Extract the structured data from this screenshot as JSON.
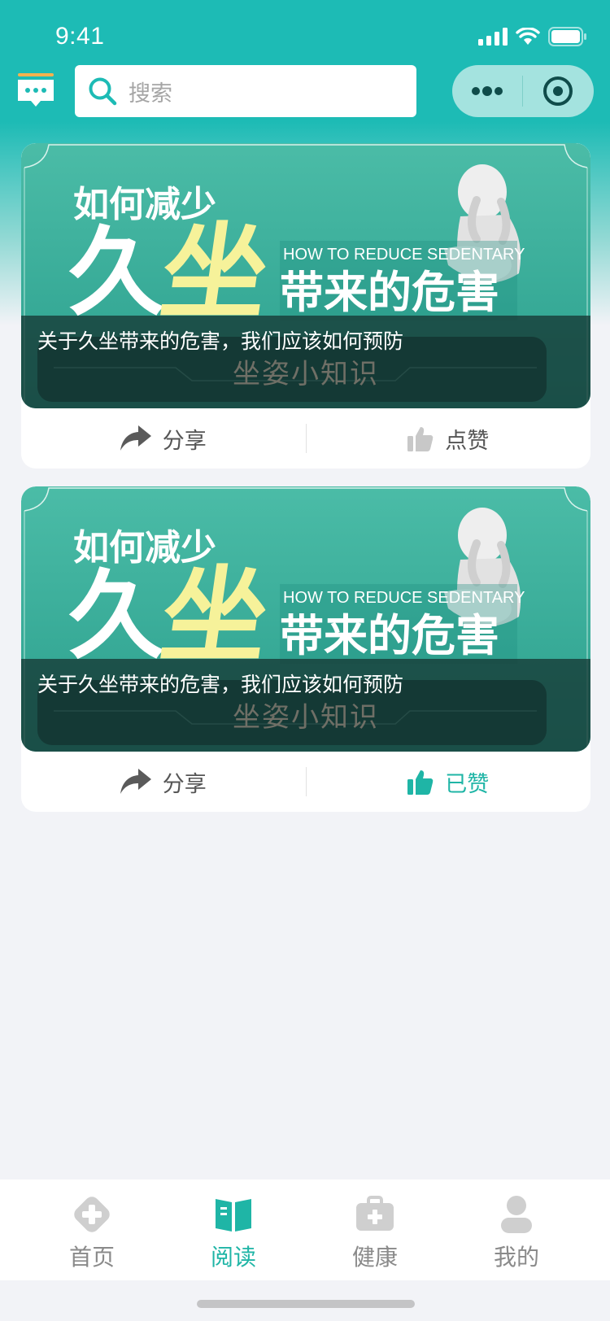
{
  "status_bar": {
    "time": "9:41"
  },
  "search": {
    "placeholder": "搜索"
  },
  "colors": {
    "brand": "#1dbbb5",
    "accent": "#1fb5a6",
    "background": "#f2f3f7"
  },
  "articles": [
    {
      "banner": {
        "line1": "如何减少",
        "big_left": "久",
        "big_right": "坐",
        "english": "HOW TO REDUCE SEDENTARY",
        "line3": "带来的危害",
        "subtitle": "坐姿小知识"
      },
      "caption": "关于久坐带来的危害，我们应该如何预防",
      "share_label": "分享",
      "like_label": "点赞",
      "liked": false
    },
    {
      "banner": {
        "line1": "如何减少",
        "big_left": "久",
        "big_right": "坐",
        "english": "HOW TO REDUCE SEDENTARY",
        "line3": "带来的危害",
        "subtitle": "坐姿小知识"
      },
      "caption": "关于久坐带来的危害，我们应该如何预防",
      "share_label": "分享",
      "like_label": "已赞",
      "liked": true
    }
  ],
  "tabbar": {
    "items": [
      {
        "label": "首页",
        "icon": "home-cross-icon",
        "active": false
      },
      {
        "label": "阅读",
        "icon": "book-icon",
        "active": true
      },
      {
        "label": "健康",
        "icon": "medical-kit-icon",
        "active": false
      },
      {
        "label": "我的",
        "icon": "user-icon",
        "active": false
      }
    ]
  }
}
